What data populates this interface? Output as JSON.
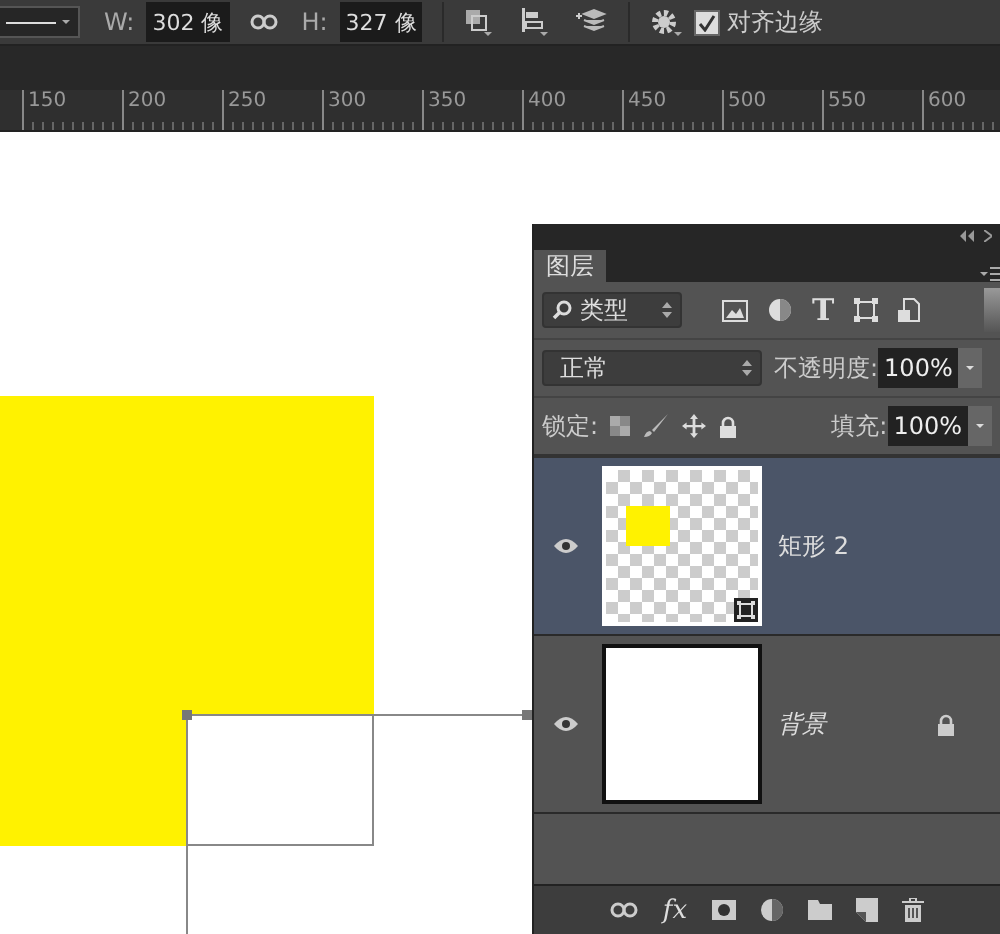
{
  "toolbar": {
    "w_label": "W:",
    "w_value": "302 像",
    "h_label": "H:",
    "h_value": "327 像",
    "align_edges": {
      "label": "对齐边缘",
      "checked": true
    }
  },
  "ruler": {
    "ticks": [
      "150",
      "200",
      "250",
      "300",
      "350",
      "400",
      "450",
      "500",
      "550",
      "600"
    ]
  },
  "layers_panel": {
    "tab": "图层",
    "filter": "类型",
    "type_filter": "T",
    "layer_style": "fx",
    "blend_mode": "正常",
    "opacity_label": "不透明度:",
    "opacity": "100%",
    "lock_label": "锁定:",
    "fill_label": "填充:",
    "fill": "100%",
    "layers": [
      {
        "name": "矩形 2",
        "kind": "shape",
        "visible": true,
        "selected": true,
        "locked": false
      },
      {
        "name": "背景",
        "kind": "background",
        "visible": true,
        "selected": false,
        "locked": true
      }
    ]
  }
}
